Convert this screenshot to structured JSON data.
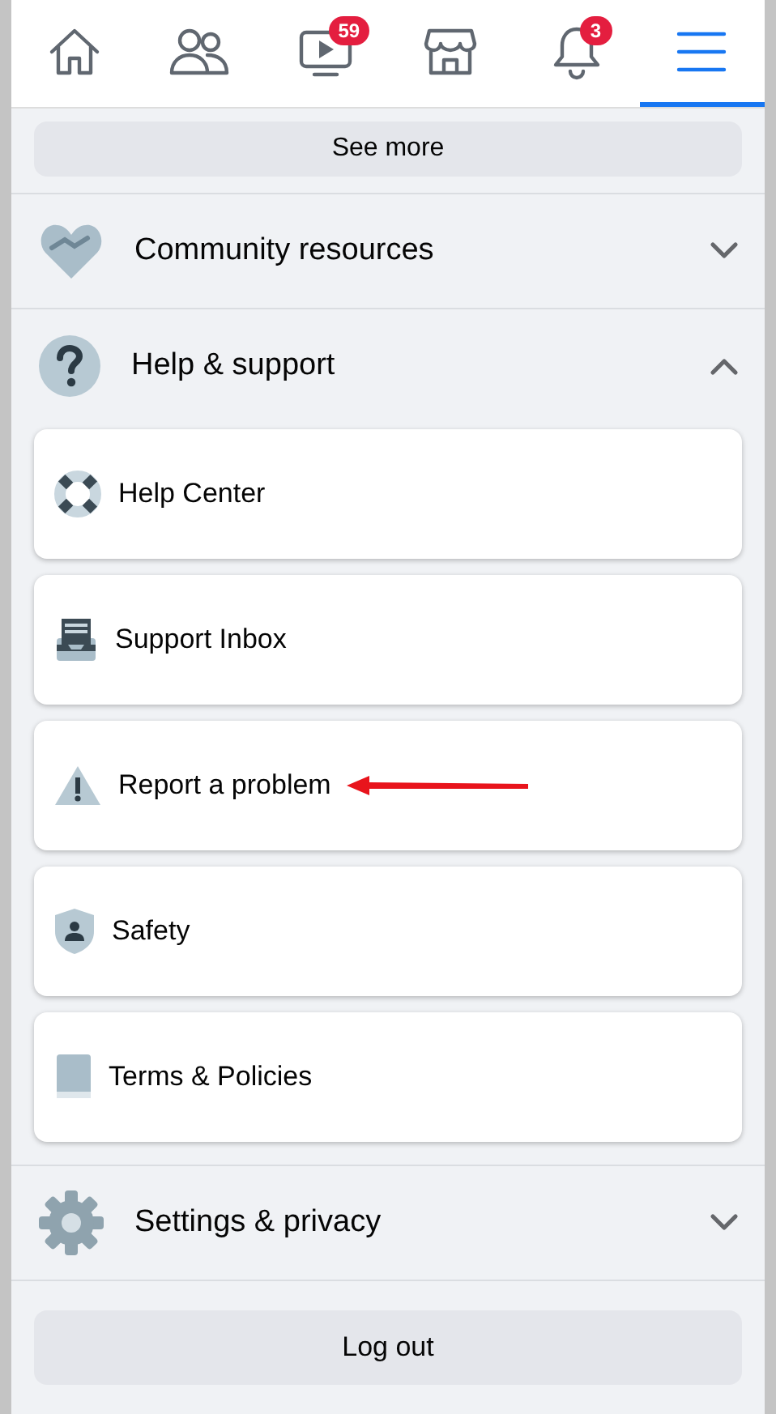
{
  "nav_tabs": [
    {
      "kind": "home",
      "selected": false
    },
    {
      "kind": "friends",
      "selected": false
    },
    {
      "kind": "watch",
      "selected": false,
      "badge": "59"
    },
    {
      "kind": "marketplace",
      "selected": false
    },
    {
      "kind": "notifications",
      "selected": false,
      "badge": "3"
    },
    {
      "kind": "menu",
      "selected": true
    }
  ],
  "see_more": "See more",
  "sections": [
    {
      "kind": "community",
      "label": "Community resources",
      "expanded": false
    },
    {
      "kind": "help",
      "label": "Help & support",
      "expanded": true,
      "items": [
        {
          "kind": "help-center",
          "label": "Help Center",
          "annotated": false
        },
        {
          "kind": "inbox",
          "label": "Support Inbox",
          "annotated": false
        },
        {
          "kind": "report",
          "label": "Report a problem",
          "annotated": true
        },
        {
          "kind": "safety",
          "label": "Safety",
          "annotated": false
        },
        {
          "kind": "terms",
          "label": "Terms & Policies",
          "annotated": false
        }
      ]
    },
    {
      "kind": "settings",
      "label": "Settings & privacy",
      "expanded": false
    }
  ],
  "logout": "Log out"
}
